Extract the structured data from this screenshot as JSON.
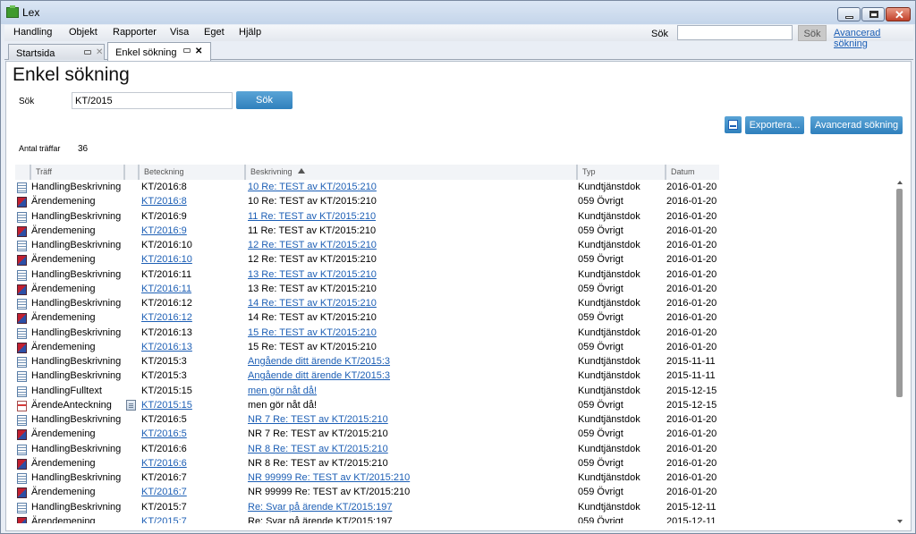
{
  "window": {
    "title": "Lex"
  },
  "menu": {
    "items": [
      "Handling",
      "Objekt",
      "Rapporter",
      "Visa",
      "Eget",
      "Hjälp"
    ],
    "search_label": "Sök",
    "search_value": "",
    "search_button": "Sök",
    "advanced_link": "Avancerad sökning"
  },
  "tabs": [
    {
      "label": "Startsida",
      "active": false
    },
    {
      "label": "Enkel sökning",
      "active": true
    }
  ],
  "page": {
    "title": "Enkel sökning",
    "search_label": "Sök",
    "search_value": "KT/2015",
    "search_button": "Sök",
    "export_button": "Exportera...",
    "advanced_button": "Avancerad sökning",
    "count_label": "Antal träffar",
    "count_value": "36"
  },
  "grid": {
    "columns": [
      "Träff",
      "Beteckning",
      "Beskrivning",
      "Typ",
      "Datum"
    ],
    "sorted_column": "Beskrivning",
    "rows": [
      {
        "icon": "document-icon",
        "traff": "HandlingBeskrivning",
        "beteckning": "KT/2016:8",
        "beteckning_link": false,
        "beskrivning": "10 Re: TEST av KT/2015:210",
        "beskrivning_link": true,
        "typ": "Kundtjänstdok",
        "datum": "2016-01-20"
      },
      {
        "icon": "case-icon",
        "traff": "Ärendemening",
        "beteckning": "KT/2016:8",
        "beteckning_link": true,
        "beskrivning": "10 Re: TEST av KT/2015:210",
        "beskrivning_link": false,
        "typ": "059 Övrigt",
        "datum": "2016-01-20"
      },
      {
        "icon": "document-icon",
        "traff": "HandlingBeskrivning",
        "beteckning": "KT/2016:9",
        "beteckning_link": false,
        "beskrivning": "11 Re: TEST av KT/2015:210",
        "beskrivning_link": true,
        "typ": "Kundtjänstdok",
        "datum": "2016-01-20"
      },
      {
        "icon": "case-icon",
        "traff": "Ärendemening",
        "beteckning": "KT/2016:9",
        "beteckning_link": true,
        "beskrivning": "11 Re: TEST av KT/2015:210",
        "beskrivning_link": false,
        "typ": "059 Övrigt",
        "datum": "2016-01-20"
      },
      {
        "icon": "document-icon",
        "traff": "HandlingBeskrivning",
        "beteckning": "KT/2016:10",
        "beteckning_link": false,
        "beskrivning": "12 Re: TEST av KT/2015:210",
        "beskrivning_link": true,
        "typ": "Kundtjänstdok",
        "datum": "2016-01-20"
      },
      {
        "icon": "case-icon",
        "traff": "Ärendemening",
        "beteckning": "KT/2016:10",
        "beteckning_link": true,
        "beskrivning": "12 Re: TEST av KT/2015:210",
        "beskrivning_link": false,
        "typ": "059 Övrigt",
        "datum": "2016-01-20"
      },
      {
        "icon": "document-icon",
        "traff": "HandlingBeskrivning",
        "beteckning": "KT/2016:11",
        "beteckning_link": false,
        "beskrivning": "13 Re: TEST av KT/2015:210",
        "beskrivning_link": true,
        "typ": "Kundtjänstdok",
        "datum": "2016-01-20"
      },
      {
        "icon": "case-icon",
        "traff": "Ärendemening",
        "beteckning": "KT/2016:11",
        "beteckning_link": true,
        "beskrivning": "13 Re: TEST av KT/2015:210",
        "beskrivning_link": false,
        "typ": "059 Övrigt",
        "datum": "2016-01-20"
      },
      {
        "icon": "document-icon",
        "traff": "HandlingBeskrivning",
        "beteckning": "KT/2016:12",
        "beteckning_link": false,
        "beskrivning": "14 Re: TEST av KT/2015:210",
        "beskrivning_link": true,
        "typ": "Kundtjänstdok",
        "datum": "2016-01-20"
      },
      {
        "icon": "case-icon",
        "traff": "Ärendemening",
        "beteckning": "KT/2016:12",
        "beteckning_link": true,
        "beskrivning": "14 Re: TEST av KT/2015:210",
        "beskrivning_link": false,
        "typ": "059 Övrigt",
        "datum": "2016-01-20"
      },
      {
        "icon": "document-icon",
        "traff": "HandlingBeskrivning",
        "beteckning": "KT/2016:13",
        "beteckning_link": false,
        "beskrivning": "15 Re: TEST av KT/2015:210",
        "beskrivning_link": true,
        "typ": "Kundtjänstdok",
        "datum": "2016-01-20"
      },
      {
        "icon": "case-icon",
        "traff": "Ärendemening",
        "beteckning": "KT/2016:13",
        "beteckning_link": true,
        "beskrivning": "15 Re: TEST av KT/2015:210",
        "beskrivning_link": false,
        "typ": "059 Övrigt",
        "datum": "2016-01-20"
      },
      {
        "icon": "document-icon",
        "traff": "HandlingBeskrivning",
        "beteckning": "KT/2015:3",
        "beteckning_link": false,
        "beskrivning": "Angående ditt ärende KT/2015:3",
        "beskrivning_link": true,
        "typ": "Kundtjänstdok",
        "datum": "2015-11-11"
      },
      {
        "icon": "document-icon",
        "traff": "HandlingBeskrivning",
        "beteckning": "KT/2015:3",
        "beteckning_link": false,
        "beskrivning": "Angående ditt ärende KT/2015:3",
        "beskrivning_link": true,
        "typ": "Kundtjänstdok",
        "datum": "2015-11-11"
      },
      {
        "icon": "document-icon",
        "traff": "HandlingFulltext",
        "beteckning": "KT/2015:15",
        "beteckning_link": false,
        "beskrivning": "men gör nåt då!",
        "beskrivning_link": true,
        "typ": "Kundtjänstdok",
        "datum": "2015-12-15"
      },
      {
        "icon": "note-icon",
        "traff": "ÄrendeAnteckning",
        "beteckning": "KT/2015:15",
        "beteckning_link": true,
        "beskrivning": "men gör nåt då!",
        "beskrivning_link": false,
        "typ": "059 Övrigt",
        "datum": "2015-12-15",
        "note": true
      },
      {
        "icon": "document-icon",
        "traff": "HandlingBeskrivning",
        "beteckning": "KT/2016:5",
        "beteckning_link": false,
        "beskrivning": "NR 7 Re: TEST av KT/2015:210",
        "beskrivning_link": true,
        "typ": "Kundtjänstdok",
        "datum": "2016-01-20"
      },
      {
        "icon": "case-icon",
        "traff": "Ärendemening",
        "beteckning": "KT/2016:5",
        "beteckning_link": true,
        "beskrivning": "NR 7 Re: TEST av KT/2015:210",
        "beskrivning_link": false,
        "typ": "059 Övrigt",
        "datum": "2016-01-20"
      },
      {
        "icon": "document-icon",
        "traff": "HandlingBeskrivning",
        "beteckning": "KT/2016:6",
        "beteckning_link": false,
        "beskrivning": "NR 8 Re: TEST av KT/2015:210",
        "beskrivning_link": true,
        "typ": "Kundtjänstdok",
        "datum": "2016-01-20"
      },
      {
        "icon": "case-icon",
        "traff": "Ärendemening",
        "beteckning": "KT/2016:6",
        "beteckning_link": true,
        "beskrivning": "NR 8 Re: TEST av KT/2015:210",
        "beskrivning_link": false,
        "typ": "059 Övrigt",
        "datum": "2016-01-20"
      },
      {
        "icon": "document-icon",
        "traff": "HandlingBeskrivning",
        "beteckning": "KT/2016:7",
        "beteckning_link": false,
        "beskrivning": "NR 99999 Re: TEST av KT/2015:210",
        "beskrivning_link": true,
        "typ": "Kundtjänstdok",
        "datum": "2016-01-20"
      },
      {
        "icon": "case-icon",
        "traff": "Ärendemening",
        "beteckning": "KT/2016:7",
        "beteckning_link": true,
        "beskrivning": "NR 99999 Re: TEST av KT/2015:210",
        "beskrivning_link": false,
        "typ": "059 Övrigt",
        "datum": "2016-01-20"
      },
      {
        "icon": "document-icon",
        "traff": "HandlingBeskrivning",
        "beteckning": "KT/2015:7",
        "beteckning_link": false,
        "beskrivning": "Re: Svar på ärende KT/2015:197",
        "beskrivning_link": true,
        "typ": "Kundtjänstdok",
        "datum": "2015-12-11"
      },
      {
        "icon": "case-icon",
        "traff": "Ärendemening",
        "beteckning": "KT/2015:7",
        "beteckning_link": true,
        "beskrivning": "Re: Svar på ärende KT/2015:197",
        "beskrivning_link": false,
        "typ": "059 Övrigt",
        "datum": "2015-12-11"
      }
    ]
  }
}
